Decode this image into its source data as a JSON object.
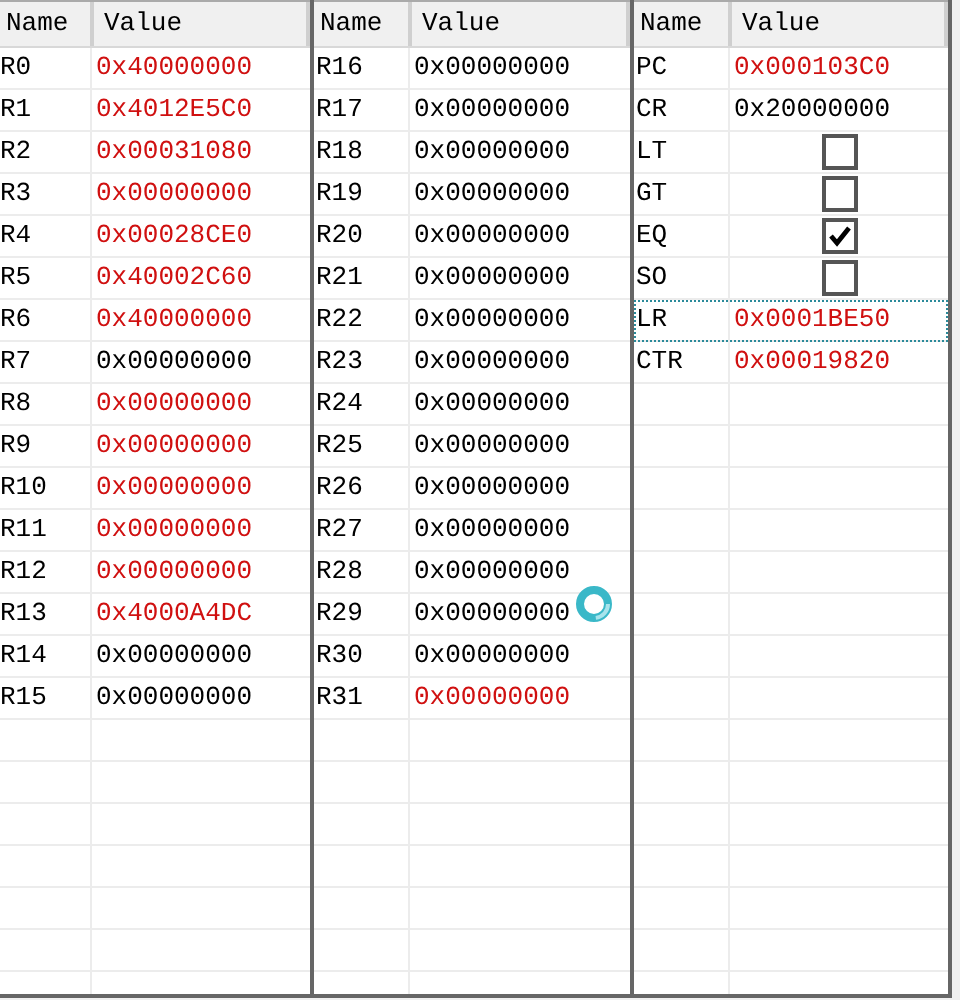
{
  "panels": [
    {
      "columns": [
        "Name",
        "Value"
      ],
      "rows": [
        {
          "kind": "value",
          "name": "R0",
          "value": "0x40000000",
          "changed": true
        },
        {
          "kind": "value",
          "name": "R1",
          "value": "0x4012E5C0",
          "changed": true
        },
        {
          "kind": "value",
          "name": "R2",
          "value": "0x00031080",
          "changed": true
        },
        {
          "kind": "value",
          "name": "R3",
          "value": "0x00000000",
          "changed": true
        },
        {
          "kind": "value",
          "name": "R4",
          "value": "0x00028CE0",
          "changed": true
        },
        {
          "kind": "value",
          "name": "R5",
          "value": "0x40002C60",
          "changed": true
        },
        {
          "kind": "value",
          "name": "R6",
          "value": "0x40000000",
          "changed": true
        },
        {
          "kind": "value",
          "name": "R7",
          "value": "0x00000000",
          "changed": false
        },
        {
          "kind": "value",
          "name": "R8",
          "value": "0x00000000",
          "changed": true
        },
        {
          "kind": "value",
          "name": "R9",
          "value": "0x00000000",
          "changed": true
        },
        {
          "kind": "value",
          "name": "R10",
          "value": "0x00000000",
          "changed": true
        },
        {
          "kind": "value",
          "name": "R11",
          "value": "0x00000000",
          "changed": true
        },
        {
          "kind": "value",
          "name": "R12",
          "value": "0x00000000",
          "changed": true
        },
        {
          "kind": "value",
          "name": "R13",
          "value": "0x4000A4DC",
          "changed": true
        },
        {
          "kind": "value",
          "name": "R14",
          "value": "0x00000000",
          "changed": false
        },
        {
          "kind": "value",
          "name": "R15",
          "value": "0x00000000",
          "changed": false
        }
      ]
    },
    {
      "columns": [
        "Name",
        "Value"
      ],
      "rows": [
        {
          "kind": "value",
          "name": "R16",
          "value": "0x00000000",
          "changed": false
        },
        {
          "kind": "value",
          "name": "R17",
          "value": "0x00000000",
          "changed": false
        },
        {
          "kind": "value",
          "name": "R18",
          "value": "0x00000000",
          "changed": false
        },
        {
          "kind": "value",
          "name": "R19",
          "value": "0x00000000",
          "changed": false
        },
        {
          "kind": "value",
          "name": "R20",
          "value": "0x00000000",
          "changed": false
        },
        {
          "kind": "value",
          "name": "R21",
          "value": "0x00000000",
          "changed": false
        },
        {
          "kind": "value",
          "name": "R22",
          "value": "0x00000000",
          "changed": false
        },
        {
          "kind": "value",
          "name": "R23",
          "value": "0x00000000",
          "changed": false
        },
        {
          "kind": "value",
          "name": "R24",
          "value": "0x00000000",
          "changed": false
        },
        {
          "kind": "value",
          "name": "R25",
          "value": "0x00000000",
          "changed": false
        },
        {
          "kind": "value",
          "name": "R26",
          "value": "0x00000000",
          "changed": false
        },
        {
          "kind": "value",
          "name": "R27",
          "value": "0x00000000",
          "changed": false
        },
        {
          "kind": "value",
          "name": "R28",
          "value": "0x00000000",
          "changed": false
        },
        {
          "kind": "value",
          "name": "R29",
          "value": "0x00000000",
          "changed": false
        },
        {
          "kind": "value",
          "name": "R30",
          "value": "0x00000000",
          "changed": false
        },
        {
          "kind": "value",
          "name": "R31",
          "value": "0x00000000",
          "changed": true
        }
      ]
    },
    {
      "columns": [
        "Name",
        "Value"
      ],
      "rows": [
        {
          "kind": "value",
          "name": "PC",
          "value": "0x000103C0",
          "changed": true,
          "focused": false
        },
        {
          "kind": "value",
          "name": "CR",
          "value": "0x20000000",
          "changed": false,
          "focused": false
        },
        {
          "kind": "flag",
          "name": "LT",
          "checked": false,
          "focused": false
        },
        {
          "kind": "flag",
          "name": "GT",
          "checked": false,
          "focused": false
        },
        {
          "kind": "flag",
          "name": "EQ",
          "checked": true,
          "focused": false
        },
        {
          "kind": "flag",
          "name": "SO",
          "checked": false,
          "focused": false
        },
        {
          "kind": "value",
          "name": "LR",
          "value": "0x0001BE50",
          "changed": true,
          "focused": true
        },
        {
          "kind": "value",
          "name": "CTR",
          "value": "0x00019820",
          "changed": true,
          "focused": false
        }
      ]
    }
  ]
}
